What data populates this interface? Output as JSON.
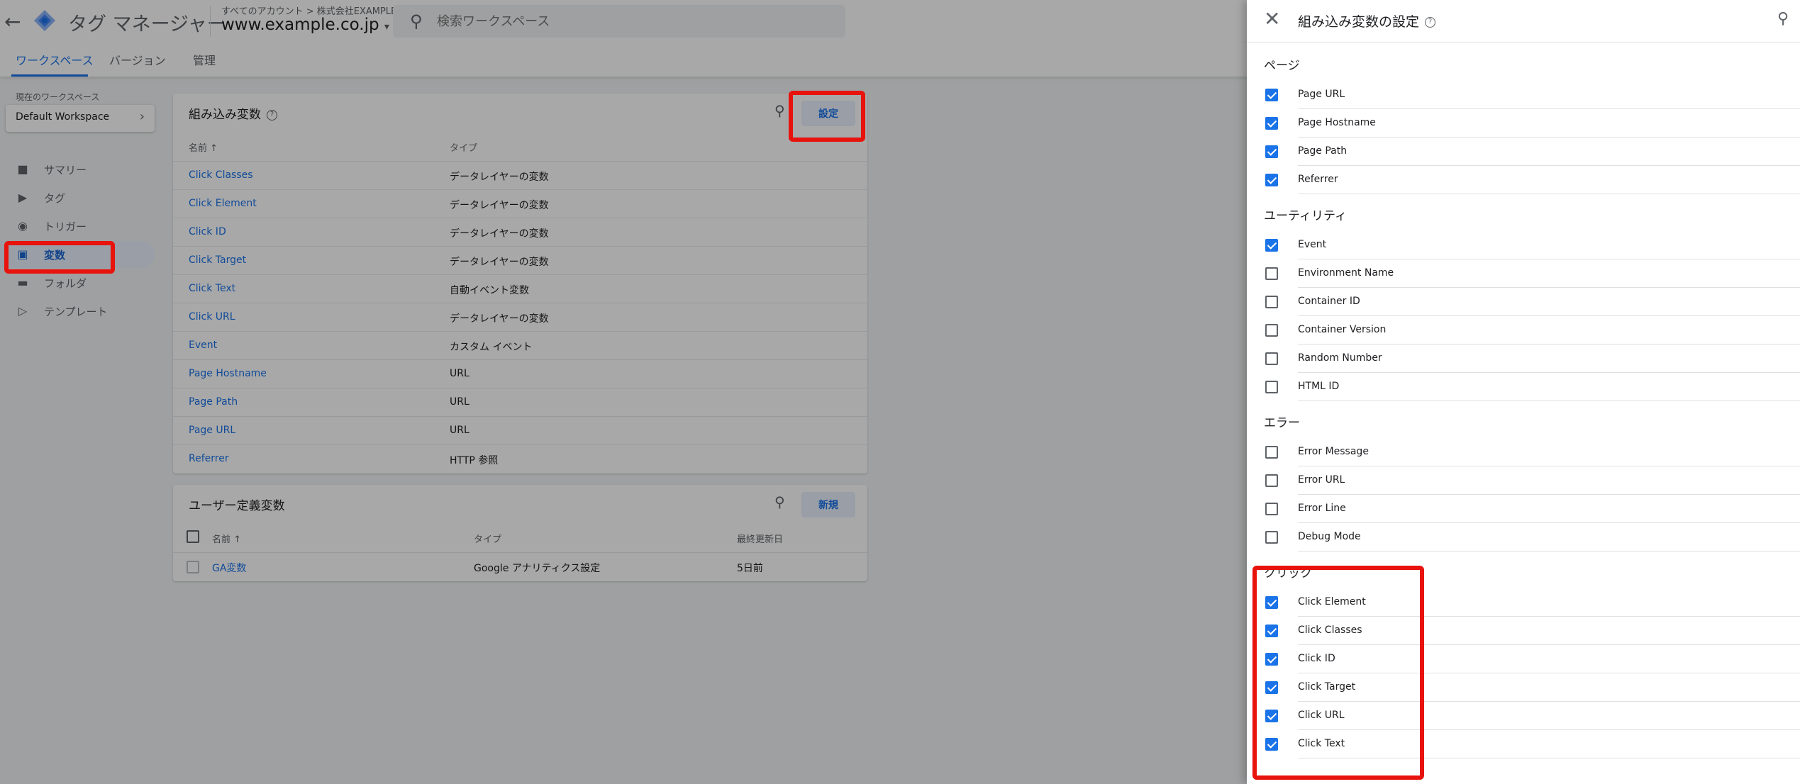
{
  "app": {
    "title": "タグ マネージャー",
    "breadcrumb": "すべてのアカウント > 株式会社EXAMPLE",
    "container": "www.example.co.jp",
    "search_placeholder": "検索ワークスペース"
  },
  "tabs": [
    "ワークスペース",
    "バージョン",
    "管理"
  ],
  "workspace": {
    "label": "現在のワークスペース",
    "name": "Default Workspace"
  },
  "sidenav": [
    {
      "label": "サマリー",
      "icon": "briefcase-icon",
      "active": false
    },
    {
      "label": "タグ",
      "icon": "tag-icon",
      "active": false
    },
    {
      "label": "トリガー",
      "icon": "trigger-icon",
      "active": false
    },
    {
      "label": "変数",
      "icon": "variables-icon",
      "active": true
    },
    {
      "label": "フォルダ",
      "icon": "folder-icon",
      "active": false
    },
    {
      "label": "テンプレート",
      "icon": "template-icon",
      "active": false
    }
  ],
  "builtin": {
    "title": "組み込み変数",
    "configure_label": "設定",
    "col_name": "名前 ↑",
    "col_type": "タイプ",
    "rows": [
      {
        "name": "Click Classes",
        "type": "データレイヤーの変数"
      },
      {
        "name": "Click Element",
        "type": "データレイヤーの変数"
      },
      {
        "name": "Click ID",
        "type": "データレイヤーの変数"
      },
      {
        "name": "Click Target",
        "type": "データレイヤーの変数"
      },
      {
        "name": "Click Text",
        "type": "自動イベント変数"
      },
      {
        "name": "Click URL",
        "type": "データレイヤーの変数"
      },
      {
        "name": "Event",
        "type": "カスタム イベント"
      },
      {
        "name": "Page Hostname",
        "type": "URL"
      },
      {
        "name": "Page Path",
        "type": "URL"
      },
      {
        "name": "Page URL",
        "type": "URL"
      },
      {
        "name": "Referrer",
        "type": "HTTP 参照"
      }
    ]
  },
  "user_defined": {
    "title": "ユーザー定義変数",
    "new_label": "新規",
    "col_name": "名前 ↑",
    "col_type": "タイプ",
    "col_updated": "最終更新日",
    "rows": [
      {
        "name": "GA変数",
        "type": "Google アナリティクス設定",
        "updated": "5日前"
      }
    ]
  },
  "panel": {
    "title": "組み込み変数の設定",
    "sections": [
      {
        "heading": "ページ",
        "options": [
          {
            "label": "Page URL",
            "checked": true
          },
          {
            "label": "Page Hostname",
            "checked": true
          },
          {
            "label": "Page Path",
            "checked": true
          },
          {
            "label": "Referrer",
            "checked": true
          }
        ]
      },
      {
        "heading": "ユーティリティ",
        "options": [
          {
            "label": "Event",
            "checked": true
          },
          {
            "label": "Environment Name",
            "checked": false
          },
          {
            "label": "Container ID",
            "checked": false
          },
          {
            "label": "Container Version",
            "checked": false
          },
          {
            "label": "Random Number",
            "checked": false
          },
          {
            "label": "HTML ID",
            "checked": false
          }
        ]
      },
      {
        "heading": "エラー",
        "options": [
          {
            "label": "Error Message",
            "checked": false
          },
          {
            "label": "Error URL",
            "checked": false
          },
          {
            "label": "Error Line",
            "checked": false
          },
          {
            "label": "Debug Mode",
            "checked": false
          }
        ]
      },
      {
        "heading": "クリック",
        "options": [
          {
            "label": "Click Element",
            "checked": true
          },
          {
            "label": "Click Classes",
            "checked": true
          },
          {
            "label": "Click ID",
            "checked": true
          },
          {
            "label": "Click Target",
            "checked": true
          },
          {
            "label": "Click URL",
            "checked": true
          },
          {
            "label": "Click Text",
            "checked": true
          }
        ]
      }
    ]
  },
  "colors": {
    "accent": "#1a73e8",
    "highlight": "#e8130d"
  }
}
